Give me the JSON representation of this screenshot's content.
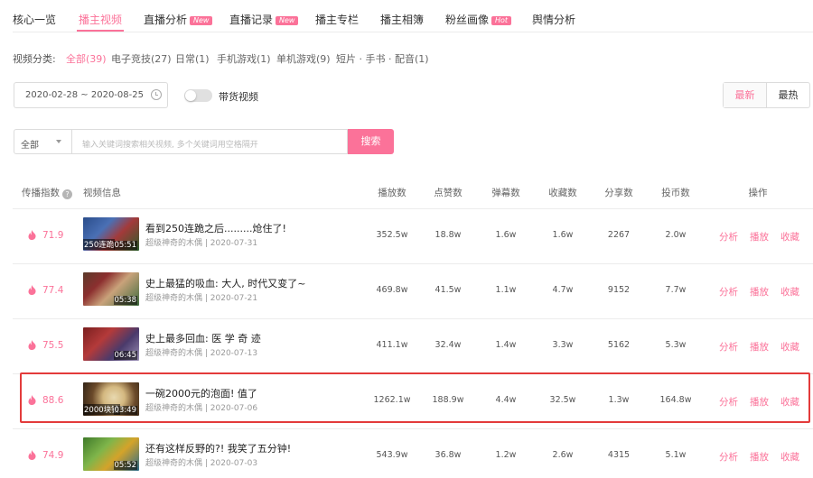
{
  "tabs": [
    {
      "label": "核心一览",
      "badge": ""
    },
    {
      "label": "播主视频",
      "badge": ""
    },
    {
      "label": "直播分析",
      "badge": "New"
    },
    {
      "label": "直播记录",
      "badge": "New"
    },
    {
      "label": "播主专栏",
      "badge": ""
    },
    {
      "label": "播主相簿",
      "badge": ""
    },
    {
      "label": "粉丝画像",
      "badge": "Hot"
    },
    {
      "label": "舆情分析",
      "badge": ""
    }
  ],
  "categories": {
    "label": "视频分类:",
    "items": [
      "全部(39)",
      "电子竞技(27)",
      "日常(1)",
      "手机游戏(1)",
      "单机游戏(9)",
      "短片 · 手书 · 配音(1)"
    ]
  },
  "filters": {
    "date_range": "2020-02-28 ~ 2020-08-25",
    "toggle_label": "带货视频",
    "sort_latest": "最新",
    "sort_hot": "最热"
  },
  "search": {
    "scope": "全部",
    "placeholder": "输入关键词搜索相关视频, 多个关键词用空格隔开",
    "button": "搜索"
  },
  "table": {
    "headers": {
      "index": "传播指数",
      "info": "视频信息",
      "plays": "播放数",
      "likes": "点赞数",
      "danmaku": "弹幕数",
      "favs": "收藏数",
      "shares": "分享数",
      "coins": "投币数",
      "ops": "操作"
    },
    "actions": {
      "analyze": "分析",
      "play": "播放",
      "fav": "收藏"
    },
    "rows": [
      {
        "score": "71.9",
        "title": "看到250连跪之后.........炝住了!",
        "author": "超级神奇的木偶",
        "date": "2020-07-31",
        "duration": "05:51",
        "overlay": "250连跪",
        "plays": "352.5w",
        "likes": "18.8w",
        "danmaku": "1.6w",
        "favs": "1.6w",
        "shares": "2267",
        "coins": "2.0w"
      },
      {
        "score": "77.4",
        "title": "史上最猛的吸血: 大人, 时代又变了~",
        "author": "超级神奇的木偶",
        "date": "2020-07-21",
        "duration": "05:38",
        "overlay": "",
        "plays": "469.8w",
        "likes": "41.5w",
        "danmaku": "1.1w",
        "favs": "4.7w",
        "shares": "9152",
        "coins": "7.7w"
      },
      {
        "score": "75.5",
        "title": "史上最多回血: 医 学 奇 迹",
        "author": "超级神奇的木偶",
        "date": "2020-07-13",
        "duration": "06:45",
        "overlay": "",
        "plays": "411.1w",
        "likes": "32.4w",
        "danmaku": "1.4w",
        "favs": "3.3w",
        "shares": "5162",
        "coins": "5.3w"
      },
      {
        "score": "88.6",
        "title": "一碗2000元的泡面! 值了",
        "author": "超级神奇的木偶",
        "date": "2020-07-06",
        "duration": "03:49",
        "overlay": "2000块钱",
        "plays": "1262.1w",
        "likes": "188.9w",
        "danmaku": "4.4w",
        "favs": "32.5w",
        "shares": "1.3w",
        "coins": "164.8w"
      },
      {
        "score": "74.9",
        "title": "还有这样反野的?! 我笑了五分钟!",
        "author": "超级神奇的木偶",
        "date": "2020-07-03",
        "duration": "05:52",
        "overlay": "",
        "plays": "543.9w",
        "likes": "36.8w",
        "danmaku": "1.2w",
        "favs": "2.6w",
        "shares": "4315",
        "coins": "5.1w"
      }
    ]
  },
  "colors": {
    "accent": "#fb7299",
    "highlight_border": "#e33b3b"
  }
}
